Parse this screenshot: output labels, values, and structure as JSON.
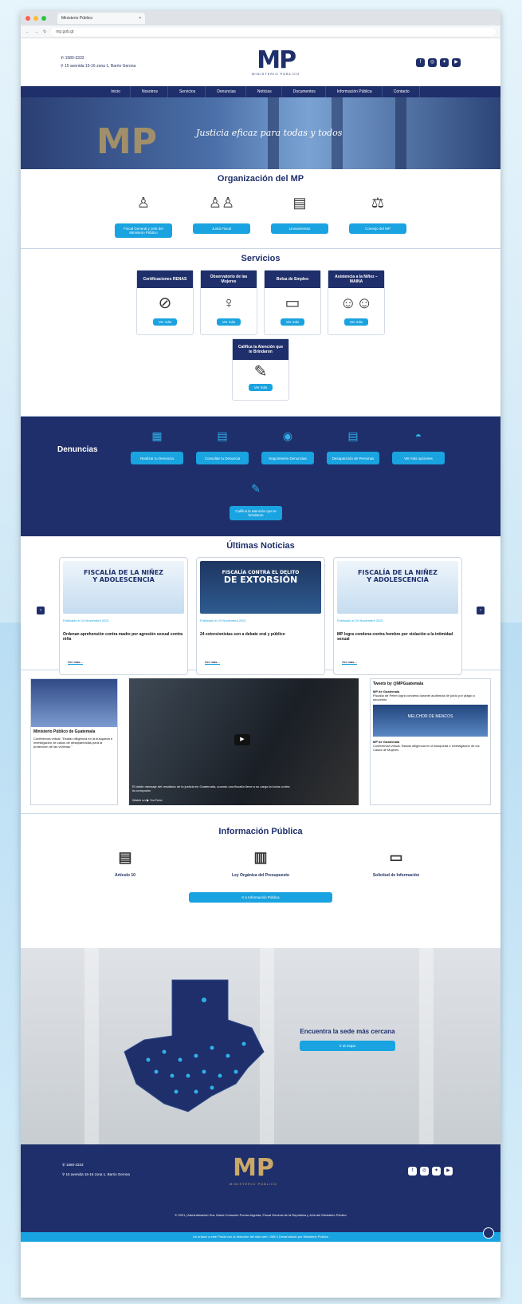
{
  "browser": {
    "tab_title": "Ministerio Público",
    "url": "mp.gob.gt"
  },
  "header": {
    "phone": "1580-3333",
    "address": "15 avenida 15-16 zona 1, Barrio Gerona",
    "logo_text": "MP",
    "logo_sub": "MINISTERIO PÚBLICO",
    "socials": [
      "facebook-icon",
      "instagram-icon",
      "twitter-icon",
      "youtube-icon"
    ]
  },
  "nav": {
    "items": [
      "Inicio",
      "Nosotros",
      "Servicios",
      "Denuncias",
      "Noticias",
      "Documentos",
      "Información Pública",
      "Contacto"
    ]
  },
  "hero": {
    "logo_text": "MP",
    "slogan": "Justicia eficaz para todas y todos"
  },
  "org": {
    "title": "Organización del MP",
    "items": [
      {
        "label": "Fiscal General y Jefe del Ministerio Público",
        "icon": "person-icon"
      },
      {
        "label": "Junta Fiscal",
        "icon": "group-icon"
      },
      {
        "label": "Lineamientos",
        "icon": "document-icon"
      },
      {
        "label": "Consejo del MP",
        "icon": "council-icon"
      }
    ]
  },
  "servicios": {
    "title": "Servicios",
    "more_label": "Ver más",
    "cards": [
      {
        "title": "Certificaciones RENAS",
        "icon": "no-violence-icon"
      },
      {
        "title": "Observatorio de las Mujeres",
        "icon": "woman-icon"
      },
      {
        "title": "Bolsa de Empleo",
        "icon": "briefcase-icon"
      },
      {
        "title": "Asistencia a la Niñez – MAINA",
        "icon": "children-icon"
      }
    ],
    "extra": {
      "title": "Califica la Atención que te Brindaron",
      "icon": "rating-icon"
    }
  },
  "denuncias": {
    "title": "Denuncias",
    "items": [
      {
        "label": "Realizar tu Denuncia",
        "icon": "form-icon"
      },
      {
        "label": "Consultar tu Denuncia",
        "icon": "search-doc-icon"
      },
      {
        "label": "Seguimiento Denuncias",
        "icon": "tracking-icon"
      },
      {
        "label": "Desaparición de Personas",
        "icon": "missing-icon"
      },
      {
        "label": "Ver más opciones",
        "icon": "compass-icon"
      }
    ],
    "extra": {
      "label": "Califica la atención que te brindaron",
      "icon": "rating-icon"
    }
  },
  "noticias": {
    "title": "Últimas Noticias",
    "more_label": "Ver más...",
    "cards": [
      {
        "image_title_1": "FISCALÍA DE LA NIÑEZ",
        "image_title_2": "Y ADOLESCENCIA",
        "date": "Publicado el 19 Noviembre 2021",
        "title": "Ordenan aprehensión contra madre por agresión sexual contra niña"
      },
      {
        "image_title_1": "FISCALÍA CONTRA EL DELITO",
        "image_title_2": "DE EXTORSIÓN",
        "date": "Publicado el 19 Noviembre 2021",
        "title": "24 extorsionistas son a debate oral y público"
      },
      {
        "image_title_1": "FISCALÍA DE LA NIÑEZ",
        "image_title_2": "Y ADOLESCENCIA",
        "date": "Publicado el 19 Noviembre 2021",
        "title": "MP logra condena contra hombre por violación a la intimidad sexual"
      }
    ]
  },
  "media": {
    "fb_page": "Ministerio Público de Guatemala",
    "fb_post": "Conferencia virtual: \"Estado diligencia en la búsqueda e investigación de casos de desaparecidas para la protección de las víctimas.\"",
    "video_caption": "El doble mensaje del resultado de la justicia en Guatemala, cuando una fiscalía tiene a su cargo la lucha contra la corrupción",
    "video_watch": "Watch on ▶ YouTube",
    "tweets_header": "Tweets by @MPGuatemala",
    "tweet_author": "MP de Guatemala",
    "tweet_text": "Fiscalía de Petén logra condena durante audiencia de juicio por plagio o secuestro",
    "tweet_img": "MELCHOR DE MENCOS",
    "tweet2_text": "Conferencia virtual: Estado diligencia en la búsqueda e investigación de los Casos de Mujeres"
  },
  "info": {
    "title": "Información Pública",
    "items": [
      {
        "label": "Artículo 10",
        "icon": "ledger-icon"
      },
      {
        "label": "Ley Orgánica del Presupuesto",
        "icon": "docs-icon"
      },
      {
        "label": "Solicitud de Información",
        "icon": "id-card-icon"
      }
    ],
    "button": "Ir a Información Pública"
  },
  "sede": {
    "title": "Encuentra la sede más cercana",
    "button": "Ir al mapa"
  },
  "footer": {
    "phone": "1580-3333",
    "address": "15 avenida 15-16 zona 1, Barrio Gerona",
    "logo_text": "MP",
    "logo_sub": "MINISTERIO PÚBLICO",
    "copyright": "© 2021 | Administración Dra. María Consuelo Porras Argueta, Fiscal General de la República y Jefa del Ministerio Público",
    "bottom": "Un enlace a este Portal con la dirección del sitio web: 1580 | Desarrollado por Ministerio Público"
  },
  "colors": {
    "navy": "#1f2f6b",
    "accent": "#19a3e0"
  }
}
